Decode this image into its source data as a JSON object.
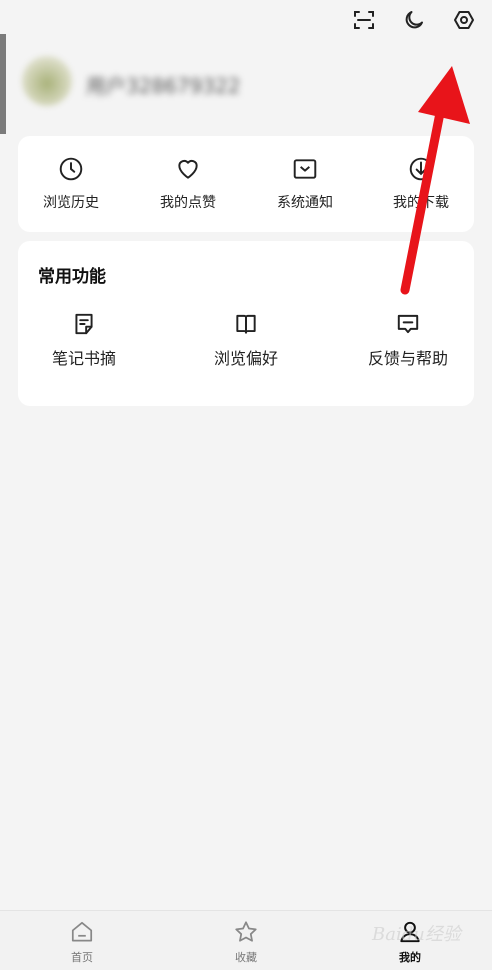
{
  "header": {
    "scan_icon": "scan-icon",
    "night_icon": "moon-icon",
    "settings_icon": "settings-icon"
  },
  "profile": {
    "username": "用户328679322"
  },
  "shortcuts": [
    {
      "label": "浏览历史",
      "icon": "clock-icon"
    },
    {
      "label": "我的点赞",
      "icon": "heart-icon"
    },
    {
      "label": "系统通知",
      "icon": "inbox-icon"
    },
    {
      "label": "我的下载",
      "icon": "download-icon"
    }
  ],
  "common": {
    "title": "常用功能",
    "items": [
      {
        "label": "笔记书摘",
        "icon": "note-icon"
      },
      {
        "label": "浏览偏好",
        "icon": "book-icon"
      },
      {
        "label": "反馈与帮助",
        "icon": "feedback-icon"
      }
    ]
  },
  "bottom_nav": [
    {
      "label": "首页",
      "icon": "home-icon",
      "active": false
    },
    {
      "label": "收藏",
      "icon": "star-icon",
      "active": false
    },
    {
      "label": "我的",
      "icon": "user-icon",
      "active": true
    }
  ],
  "watermark": "Baidu经验",
  "colors": {
    "arrow": "#e8141a",
    "background": "#f4f4f4",
    "card": "#ffffff"
  }
}
